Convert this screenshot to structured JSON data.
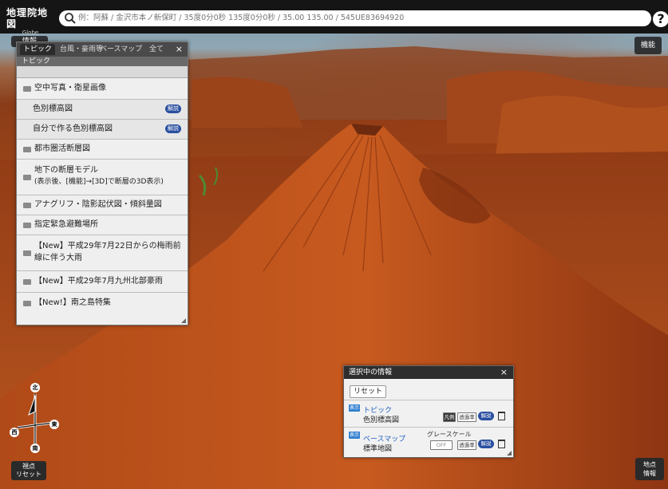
{
  "header": {
    "logo_title": "地理院地図",
    "logo_subtitle": "Globe",
    "search_placeholder": "例：阿蘇 / 金沢市本ノ新保町 / 35度0分0秒 135度0分0秒 / 35.00 135.00 / 545UE83694920",
    "help_label": "?"
  },
  "controls": {
    "function_label": "機能",
    "menu_label": "情報"
  },
  "topic_panel": {
    "tabs": [
      "トピック",
      "台風・豪雨等",
      "ベースマップ",
      "全て"
    ],
    "close_label": "×",
    "subheader": "トピック",
    "items": [
      {
        "label": "空中写真・衛星画像",
        "kind": "folder"
      },
      {
        "label": "色別標高図",
        "kind": "sub",
        "badge": "解説"
      },
      {
        "label": "自分で作る色別標高図",
        "kind": "sub",
        "badge": "解説"
      },
      {
        "label": "都市圏活断層図",
        "kind": "folder"
      },
      {
        "label": "地下の断層モデル",
        "label2": "(表示後、[機能]→[3D]で断層の3D表示)",
        "kind": "folder"
      },
      {
        "label": "アナグリフ・陰影起伏図・傾斜量図",
        "kind": "folder"
      },
      {
        "label": "指定緊急避難場所",
        "kind": "folder"
      },
      {
        "label": "【New】平成29年7月22日からの梅雨前",
        "label2": "線に伴う大雨",
        "kind": "folder"
      },
      {
        "label": "【New】平成29年7月九州北部豪雨",
        "kind": "folder"
      },
      {
        "label": "【New!】南之島特集",
        "kind": "folder"
      }
    ]
  },
  "info_panel": {
    "title": "選択中の情報",
    "close_label": "×",
    "reset_label": "リセット",
    "layers": [
      {
        "show_tag": "表示",
        "type": "トピック",
        "name": "色別標高図",
        "btn1": "凡例",
        "btn2": "透過率",
        "explain": "解説"
      },
      {
        "show_tag": "表示",
        "type": "ベースマップ",
        "name": "標準地図",
        "grayscale_label": "グレースケール",
        "toggle": "OFF",
        "btn2": "透過率",
        "explain": "解説"
      }
    ]
  },
  "compass": {
    "north": "北",
    "south": "南",
    "east": "東",
    "west": "西"
  },
  "bottom": {
    "reset_view_line1": "視点",
    "reset_view_line2": "リセット",
    "point_info_line1": "地点",
    "point_info_line2": "情報"
  }
}
